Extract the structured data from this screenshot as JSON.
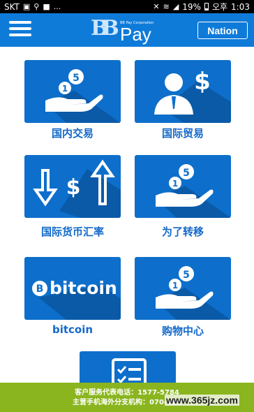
{
  "status_bar": {
    "carrier": "SKT",
    "battery": "19%",
    "period": "오후",
    "time": "1:03"
  },
  "header": {
    "logo_corp": "BB Pay Corporation",
    "logo_word": "Pay",
    "nation_label": "Nation"
  },
  "menu": {
    "items": [
      {
        "label": "国内交易",
        "icon": "hand-coins-icon"
      },
      {
        "label": "国际贸易",
        "icon": "businessman-dollar-icon"
      },
      {
        "label": "国际货币汇率",
        "icon": "exchange-arrows-icon"
      },
      {
        "label": "为了转移",
        "icon": "hand-coins-icon"
      },
      {
        "label": "bitcoin",
        "icon": "bitcoin-logo-icon",
        "logo_text": "bitcoin"
      },
      {
        "label": "购物中心",
        "icon": "hand-coins-icon"
      },
      {
        "label": "",
        "icon": "checklist-icon"
      }
    ]
  },
  "footer": {
    "line1": "客户服务代表电话：1577-5784",
    "line2": "主营手机海外分支机构：070-411"
  },
  "watermark": "www.365jz.com",
  "colors": {
    "header": "#0f7bd9",
    "tile": "#0d6fcb",
    "label": "#1469c9",
    "footer": "#8ab51f"
  }
}
